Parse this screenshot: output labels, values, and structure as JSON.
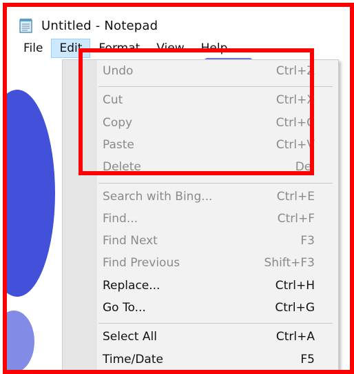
{
  "window": {
    "title": "Untitled - Notepad"
  },
  "menubar": {
    "items": [
      "File",
      "Edit",
      "Format",
      "View",
      "Help"
    ],
    "active_index": 1
  },
  "edit_menu": {
    "groups": [
      [
        {
          "label": "Undo",
          "shortcut": "Ctrl+Z",
          "enabled": false
        }
      ],
      [
        {
          "label": "Cut",
          "shortcut": "Ctrl+X",
          "enabled": false
        },
        {
          "label": "Copy",
          "shortcut": "Ctrl+C",
          "enabled": false
        },
        {
          "label": "Paste",
          "shortcut": "Ctrl+V",
          "enabled": false
        },
        {
          "label": "Delete",
          "shortcut": "Del",
          "enabled": false
        }
      ],
      [
        {
          "label": "Search with Bing...",
          "shortcut": "Ctrl+E",
          "enabled": false
        },
        {
          "label": "Find...",
          "shortcut": "Ctrl+F",
          "enabled": false
        },
        {
          "label": "Find Next",
          "shortcut": "F3",
          "enabled": false
        },
        {
          "label": "Find Previous",
          "shortcut": "Shift+F3",
          "enabled": false
        },
        {
          "label": "Replace...",
          "shortcut": "Ctrl+H",
          "enabled": true
        },
        {
          "label": "Go To...",
          "shortcut": "Ctrl+G",
          "enabled": true
        }
      ],
      [
        {
          "label": "Select All",
          "shortcut": "Ctrl+A",
          "enabled": true
        },
        {
          "label": "Time/Date",
          "shortcut": "F5",
          "enabled": true
        }
      ]
    ]
  },
  "colors": {
    "annotation_red": "#ff0000",
    "menu_active_bg": "#cce8ff",
    "disabled_text": "#8a8a8a",
    "enabled_text": "#111111",
    "watermark_blue": "#2f3dd6"
  },
  "icons": {
    "app": "notepad-icon"
  }
}
